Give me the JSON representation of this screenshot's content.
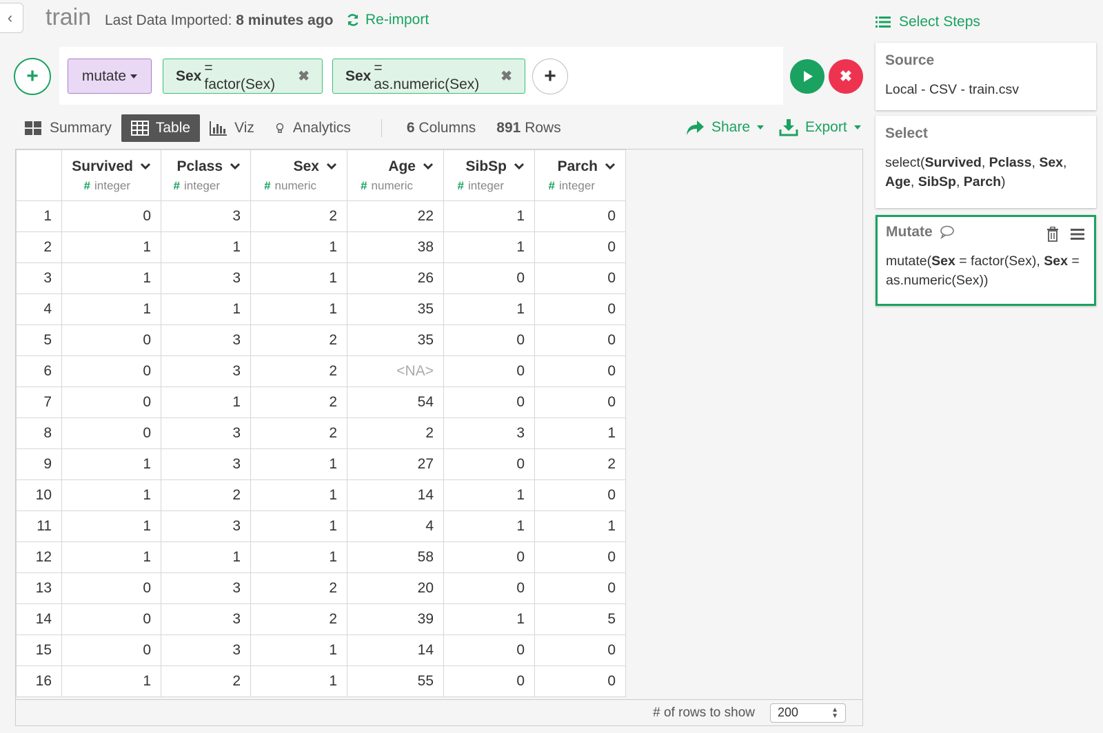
{
  "header": {
    "back_glyph": "‹",
    "title": "train",
    "last_import_label": "Last Data Imported:",
    "last_import_value": "8 minutes ago",
    "reimport_label": "Re-import"
  },
  "command": {
    "add_glyph": "+",
    "verb": "mutate",
    "tokens": [
      {
        "name": "Sex",
        "expr": "= factor(Sex)"
      },
      {
        "name": "Sex",
        "expr": "= as.numeric(Sex)"
      }
    ],
    "remove_glyph": "✖",
    "plus_glyph": "+",
    "cancel_glyph": "✖"
  },
  "tabs": {
    "summary": "Summary",
    "table": "Table",
    "viz": "Viz",
    "analytics": "Analytics",
    "columns_count": "6",
    "columns_label": "Columns",
    "rows_count": "891",
    "rows_label": "Rows",
    "share": "Share",
    "export": "Export"
  },
  "table": {
    "columns": [
      {
        "name": "Survived",
        "type": "integer"
      },
      {
        "name": "Pclass",
        "type": "integer"
      },
      {
        "name": "Sex",
        "type": "numeric"
      },
      {
        "name": "Age",
        "type": "numeric"
      },
      {
        "name": "SibSp",
        "type": "integer"
      },
      {
        "name": "Parch",
        "type": "integer"
      }
    ],
    "type_prefix": "#",
    "rows": [
      [
        "1",
        "0",
        "3",
        "2",
        "22",
        "1",
        "0"
      ],
      [
        "2",
        "1",
        "1",
        "1",
        "38",
        "1",
        "0"
      ],
      [
        "3",
        "1",
        "3",
        "1",
        "26",
        "0",
        "0"
      ],
      [
        "4",
        "1",
        "1",
        "1",
        "35",
        "1",
        "0"
      ],
      [
        "5",
        "0",
        "3",
        "2",
        "35",
        "0",
        "0"
      ],
      [
        "6",
        "0",
        "3",
        "2",
        "<NA>",
        "0",
        "0"
      ],
      [
        "7",
        "0",
        "1",
        "2",
        "54",
        "0",
        "0"
      ],
      [
        "8",
        "0",
        "3",
        "2",
        "2",
        "3",
        "1"
      ],
      [
        "9",
        "1",
        "3",
        "1",
        "27",
        "0",
        "2"
      ],
      [
        "10",
        "1",
        "2",
        "1",
        "14",
        "1",
        "0"
      ],
      [
        "11",
        "1",
        "3",
        "1",
        "4",
        "1",
        "1"
      ],
      [
        "12",
        "1",
        "1",
        "1",
        "58",
        "0",
        "0"
      ],
      [
        "13",
        "0",
        "3",
        "2",
        "20",
        "0",
        "0"
      ],
      [
        "14",
        "0",
        "3",
        "2",
        "39",
        "1",
        "5"
      ],
      [
        "15",
        "0",
        "3",
        "1",
        "14",
        "0",
        "0"
      ],
      [
        "16",
        "1",
        "2",
        "1",
        "55",
        "0",
        "0"
      ]
    ],
    "rows_to_show_label": "# of rows to show",
    "rows_to_show_value": "200"
  },
  "steps": {
    "title": "Select Steps",
    "source_title": "Source",
    "source_body": "Local - CSV - train.csv",
    "select_title": "Select",
    "select_parts": {
      "prefix": "select(",
      "cols": [
        "Survived",
        "Pclass",
        "Sex",
        "Age",
        "SibSp",
        "Parch"
      ],
      "sep": ", ",
      "suffix": ")"
    },
    "mutate_title": "Mutate",
    "mutate_parts": {
      "p1": "mutate(",
      "b1": "Sex",
      "p2": " = factor(Sex), ",
      "b2": "Sex",
      "p3": " = as.numeric(Sex))"
    }
  },
  "colors": {
    "accent_green": "#1aa260",
    "danger_red": "#ee3350",
    "verb_purple": "#ead9f5",
    "token_green": "#dff4e6"
  }
}
